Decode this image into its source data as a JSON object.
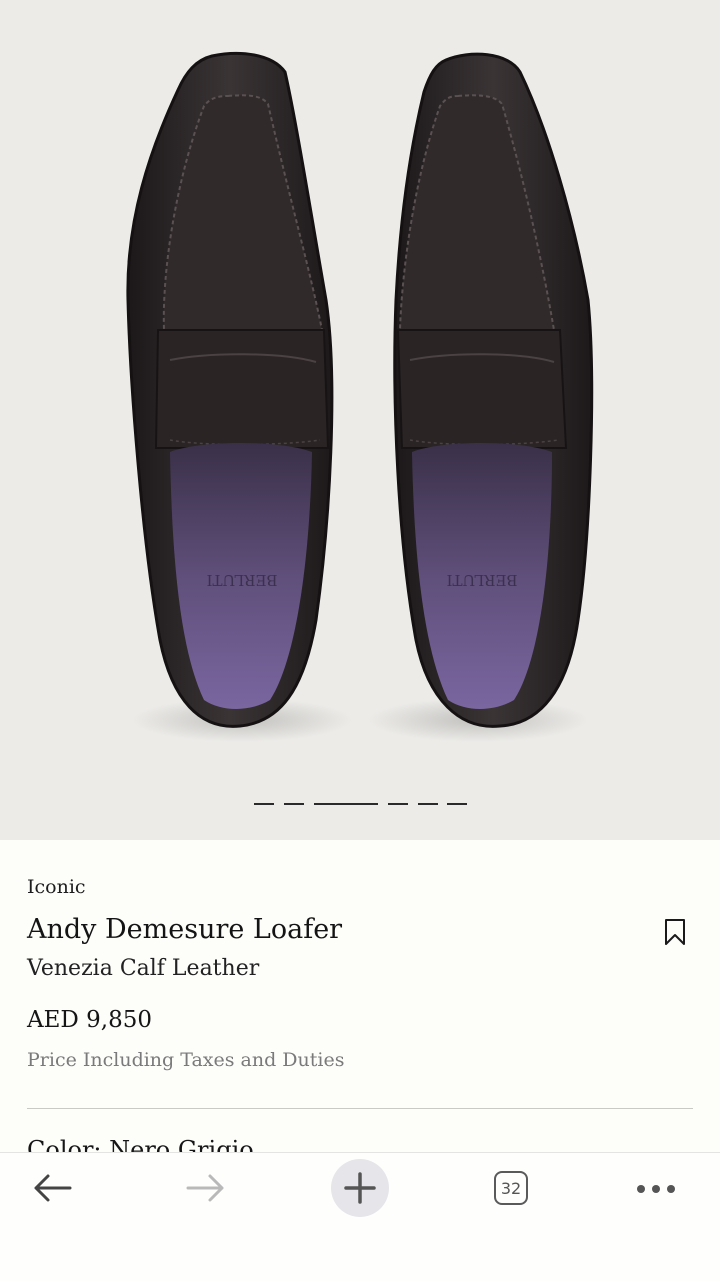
{
  "product": {
    "eyebrow": "Iconic",
    "name": "Andy Demesure Loafer",
    "material": "Venezia Calf Leather",
    "price": "AED 9,850",
    "price_note": "Price Including Taxes and Duties",
    "color_label": "Color: Nero Grigio"
  },
  "gallery": {
    "slide_count": 6,
    "active_index": 2,
    "insole_brand": "BERLUTI"
  },
  "browser": {
    "tab_count": "32",
    "icons": [
      "back-arrow-icon",
      "forward-arrow-icon",
      "plus-icon",
      "tabs-icon",
      "more-icon"
    ]
  },
  "colors": {
    "hero_bg": "#ecebe8",
    "leather": "#2b2526",
    "lining": "#6b5a86",
    "page_bg": "#fdfdfa"
  }
}
